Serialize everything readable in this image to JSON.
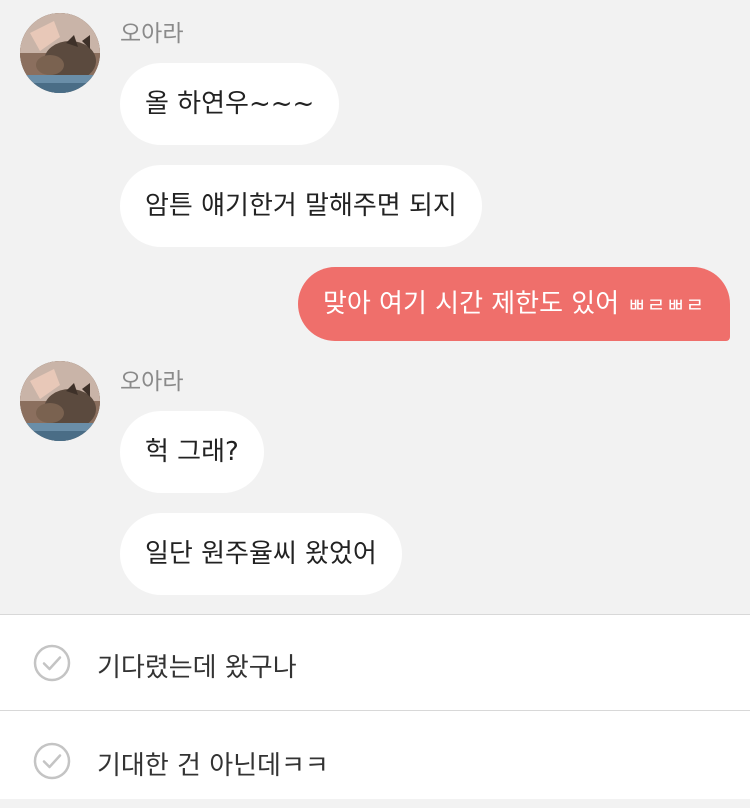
{
  "messages": [
    {
      "sender": "오아라",
      "bubbles": [
        "올 하연우~~~",
        "암튼 얘기한거 말해주면 되지"
      ]
    },
    {
      "mine": true,
      "text": "맞아 여기 시간 제한도 있어",
      "suffix": "ㅃㄹㅃㄹ"
    },
    {
      "sender": "오아라",
      "bubbles": [
        "헉 그래?",
        "일단 원주율씨 왔었어"
      ]
    }
  ],
  "replies": [
    {
      "label": "기다렸는데 왔구나",
      "icon": "check-circle-icon"
    },
    {
      "label": "기대한 건 아닌데ㅋㅋ",
      "icon": "check-circle-icon"
    }
  ],
  "colors": {
    "my_bubble": "#ef6f6b",
    "their_bubble": "#ffffff",
    "chat_background": "#f2f2f2",
    "sender_name": "#8a8a8a"
  }
}
